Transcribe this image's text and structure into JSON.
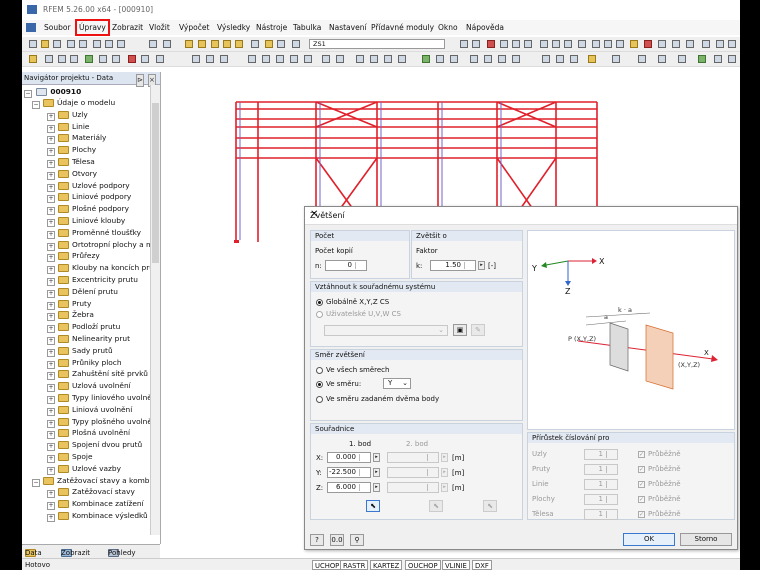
{
  "window": {
    "title": "RFEM 5.26.00 x64 - [000910]"
  },
  "menu": [
    "Soubor",
    "Úpravy",
    "Zobrazit",
    "Vložit",
    "Výpočet",
    "Výsledky",
    "Nástroje",
    "Tabulka",
    "Nastavení",
    "Přídavné moduly",
    "Okno",
    "Nápověda"
  ],
  "menu_highlighted": "Úpravy",
  "toolbar": {
    "loadcase": "ZS1"
  },
  "navigator": {
    "title": "Navigátor projektu - Data",
    "root": "000910",
    "items": [
      {
        "label": "Údaje o modelu",
        "level": 1,
        "open": true
      },
      {
        "label": "Uzly",
        "level": 2
      },
      {
        "label": "Linie",
        "level": 2
      },
      {
        "label": "Materiály",
        "level": 2
      },
      {
        "label": "Plochy",
        "level": 2
      },
      {
        "label": "Tělesa",
        "level": 2
      },
      {
        "label": "Otvory",
        "level": 2
      },
      {
        "label": "Uzlové podpory",
        "level": 2
      },
      {
        "label": "Liniové podpory",
        "level": 2
      },
      {
        "label": "Plošné podpory",
        "level": 2
      },
      {
        "label": "Liniové klouby",
        "level": 2
      },
      {
        "label": "Proměnné tloušťky",
        "level": 2
      },
      {
        "label": "Ortotropní plochy a me",
        "level": 2
      },
      {
        "label": "Průřezy",
        "level": 2
      },
      {
        "label": "Klouby na koncích prutů",
        "level": 2
      },
      {
        "label": "Excentricity prutu",
        "level": 2
      },
      {
        "label": "Dělení prutu",
        "level": 2
      },
      {
        "label": "Pruty",
        "level": 2
      },
      {
        "label": "Žebra",
        "level": 2
      },
      {
        "label": "Podloží prutu",
        "level": 2
      },
      {
        "label": "Nelinearity prut",
        "level": 2
      },
      {
        "label": "Sady prutů",
        "level": 2
      },
      {
        "label": "Průniky ploch",
        "level": 2
      },
      {
        "label": "Zahuštění sítě prvků",
        "level": 2
      },
      {
        "label": "Uzlová uvolnění",
        "level": 2
      },
      {
        "label": "Typy liniového uvolnění",
        "level": 2
      },
      {
        "label": "Liniová uvolnění",
        "level": 2
      },
      {
        "label": "Typy plošného uvolnění",
        "level": 2
      },
      {
        "label": "Plošná uvolnění",
        "level": 2
      },
      {
        "label": "Spojení dvou prutů",
        "level": 2
      },
      {
        "label": "Spoje",
        "level": 2
      },
      {
        "label": "Uzlové vazby",
        "level": 2
      },
      {
        "label": "Zatěžovací stavy a kombina",
        "level": 1,
        "open": true
      },
      {
        "label": "Zatěžovací stavy",
        "level": 2
      },
      {
        "label": "Kombinace zatížení",
        "level": 2
      },
      {
        "label": "Kombinace výsledků",
        "level": 2
      }
    ],
    "tabs": [
      "Data",
      "Zobrazit",
      "Pohledy"
    ]
  },
  "status": {
    "text": "Hotovo",
    "buttons": [
      "UCHOP",
      "RASTR",
      "KARTEZ",
      "OUCHOP",
      "VLINIE",
      "DXF"
    ]
  },
  "dialog": {
    "title": "Zvětšení",
    "pocet": {
      "header": "Počet",
      "label": "Počet kopií",
      "n_label": "n:",
      "n_value": "0"
    },
    "zvetsit": {
      "header": "Zvětšit o",
      "label": "Faktor",
      "k_label": "k:",
      "k_value": "1.50",
      "unit": "[-]"
    },
    "system": {
      "header": "Vztáhnout k souřadnému systému",
      "opt1": "Globálně X,Y,Z CS",
      "opt2": "Uživatelské U,V,W CS"
    },
    "smer": {
      "header": "Směr zvětšení",
      "opt1": "Ve všech směrech",
      "opt2": "Ve směru:",
      "dir": "Y",
      "opt3": "Ve směru zadaném dvěma body"
    },
    "coords": {
      "header": "Souřadnice",
      "col1": "1. bod",
      "col2": "2. bod",
      "rows": [
        {
          "axis": "X:",
          "v1": "0.000",
          "unit": "[m]"
        },
        {
          "axis": "Y:",
          "v1": "-22.500",
          "unit": "[m]"
        },
        {
          "axis": "Z:",
          "v1": "6.000",
          "unit": "[m]"
        }
      ]
    },
    "increment": {
      "header": "Přírůstek číslování pro",
      "rows": [
        {
          "name": "Uzly",
          "val": "1",
          "chk": "Průběžně"
        },
        {
          "name": "Pruty",
          "val": "1",
          "chk": "Průběžně"
        },
        {
          "name": "Linie",
          "val": "1",
          "chk": "Průběžně"
        },
        {
          "name": "Plochy",
          "val": "1",
          "chk": "Průběžně"
        },
        {
          "name": "Tělesa",
          "val": "1",
          "chk": "Průběžně"
        }
      ]
    },
    "picture": {
      "axis_y": "Y",
      "axis_x": "X",
      "axis_z": "Z",
      "lbl_ka": "k · a",
      "lbl_a": "a",
      "lbl_p": "P (X,Y,Z)",
      "lbl_xyz": "(X,Y,Z)"
    },
    "ok": "OK",
    "cancel": "Storno"
  }
}
